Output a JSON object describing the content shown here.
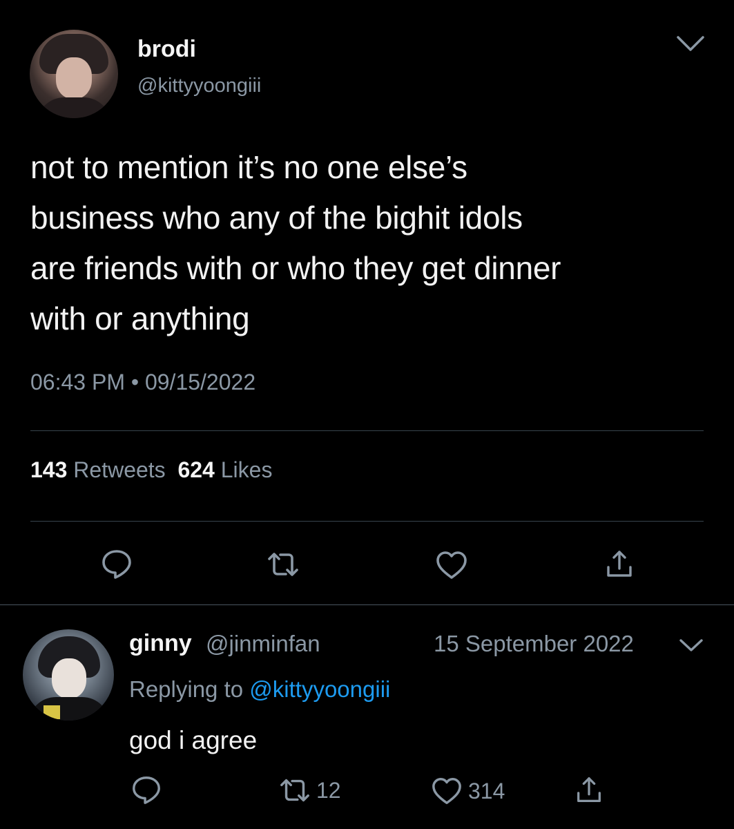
{
  "tweet": {
    "display_name": "brodi",
    "handle": "@kittyyoongiii",
    "text_lines": [
      "not to mention it’s no one else’s",
      "business who any of the bighit idols",
      "are friends with or who they get dinner",
      "with or anything"
    ],
    "time": "06:43 PM",
    "separator": "•",
    "date": "09/15/2022",
    "retweet_count": "143",
    "retweet_label": "Retweets",
    "like_count": "624",
    "like_label": "Likes",
    "icons": {
      "more": "chevron-down-icon",
      "reply": "reply-bubble-icon",
      "retweet": "retweet-icon",
      "like": "heart-icon",
      "share": "share-icon"
    }
  },
  "reply": {
    "display_name": "ginny",
    "handle": "@jinminfan",
    "date": "15 September 2022",
    "replying_prefix": "Replying to",
    "replying_to": "@kittyyoongiii",
    "text": "god i agree",
    "retweet_count": "12",
    "like_count": "314"
  },
  "colors": {
    "background": "#000000",
    "text": "#f2f2f2",
    "secondary": "#8b98a5",
    "link": "#1d9bf0",
    "divider": "#38444d"
  }
}
